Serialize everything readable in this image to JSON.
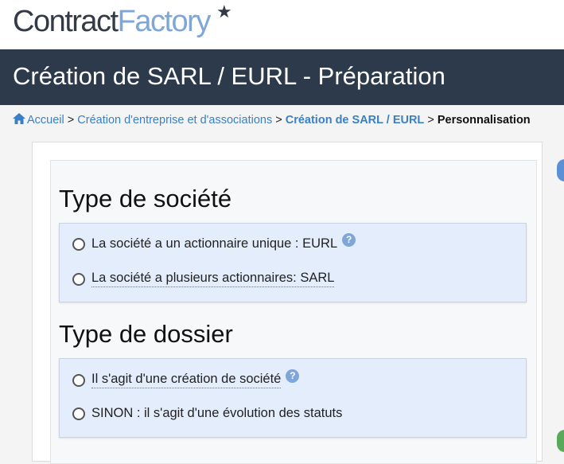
{
  "logo": {
    "part1": "Contract",
    "part2": "Factory",
    "star": "★"
  },
  "page_title": "Création de SARL / EURL - Préparation",
  "breadcrumb": {
    "home": "Accueil",
    "sep": ">",
    "level1": "Création d'entreprise et d'associations",
    "level2": "Création de SARL / EURL",
    "current": "Personnalisation"
  },
  "sections": [
    {
      "title": "Type de société",
      "options": [
        {
          "label": "La société a un actionnaire unique : EURL",
          "help": "?"
        },
        {
          "label": "La société a plusieurs actionnaires: SARL"
        }
      ]
    },
    {
      "title": "Type de dossier",
      "options": [
        {
          "label": "Il s'agit d'une création de société",
          "help": "?"
        },
        {
          "label": "SINON : il s'agit d'une évolution des statuts"
        }
      ]
    }
  ],
  "colors": {
    "header_bg": "#2c3a4b",
    "accent": "#3b7fc4",
    "option_bg": "#e3edfc",
    "logo_light": "#7fa6d8"
  },
  "icons": {
    "home": "home-icon",
    "help": "question-circle-icon",
    "radio": "radio-unchecked-icon"
  }
}
